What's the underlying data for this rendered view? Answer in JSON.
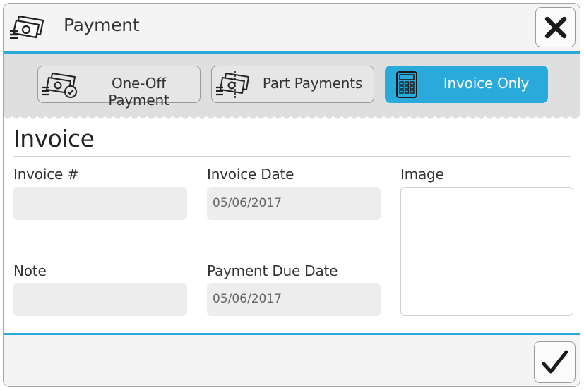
{
  "header": {
    "title": "Payment",
    "logo_icon": "money-bills-icon",
    "close_icon": "close-icon"
  },
  "tabs": [
    {
      "label": "One-Off Payment",
      "icon": "money-check-icon",
      "active": false
    },
    {
      "label": "Part Payments",
      "icon": "money-split-icon",
      "active": false
    },
    {
      "label": "Invoice Only",
      "icon": "calculator-icon",
      "active": true
    }
  ],
  "section": {
    "title": "Invoice"
  },
  "fields": {
    "invoice_number": {
      "label": "Invoice #",
      "value": ""
    },
    "invoice_date": {
      "label": "Invoice Date",
      "value": "05/06/2017"
    },
    "image": {
      "label": "Image"
    },
    "note": {
      "label": "Note",
      "value": ""
    },
    "payment_due_date": {
      "label": "Payment Due Date",
      "value": "05/06/2017"
    }
  },
  "footer": {
    "confirm_icon": "checkmark-icon"
  },
  "colors": {
    "accent": "#29a8d9",
    "tab_bar": "#dfdfdf",
    "input_bg": "#ededed"
  }
}
